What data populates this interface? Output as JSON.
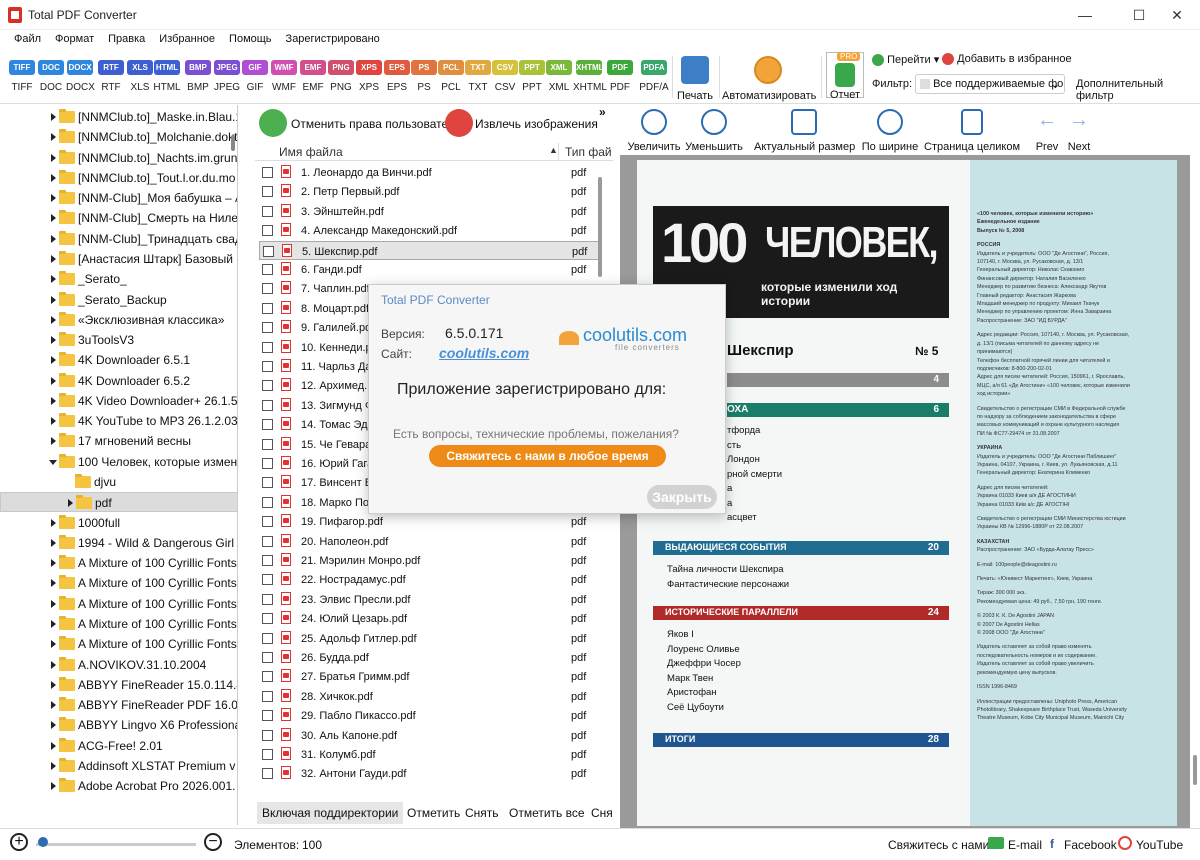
{
  "titlebar": {
    "title": "Total PDF Converter",
    "minimize": "—",
    "maximize": "☐",
    "close": "✕"
  },
  "menu": [
    "Файл",
    "Формат",
    "Правка",
    "Избранное",
    "Помощь",
    "Зарегистрировано"
  ],
  "formats": [
    {
      "label": "TIFF",
      "color": "#2e86de"
    },
    {
      "label": "DOC",
      "color": "#2e86de"
    },
    {
      "label": "DOCX",
      "color": "#2e86de"
    },
    {
      "label": "RTF",
      "color": "#3d5fd1"
    },
    {
      "label": "XLS",
      "color": "#3d5fd1"
    },
    {
      "label": "HTML",
      "color": "#3d5fd1"
    },
    {
      "label": "BMP",
      "color": "#7b4fd1"
    },
    {
      "label": "JPEG",
      "color": "#7b4fd1"
    },
    {
      "label": "GIF",
      "color": "#b04fd1"
    },
    {
      "label": "WMF",
      "color": "#d14fb0"
    },
    {
      "label": "EMF",
      "color": "#d14f8a"
    },
    {
      "label": "PNG",
      "color": "#d14f6a"
    },
    {
      "label": "XPS",
      "color": "#e0443f"
    },
    {
      "label": "EPS",
      "color": "#e05a3f"
    },
    {
      "label": "PS",
      "color": "#e0743f"
    },
    {
      "label": "PCL",
      "color": "#e08e3f"
    },
    {
      "label": "TXT",
      "color": "#e0a83f"
    },
    {
      "label": "CSV",
      "color": "#d4c23a"
    },
    {
      "label": "PPT",
      "color": "#a8c23a"
    },
    {
      "label": "XML",
      "color": "#7ab83a"
    },
    {
      "label": "XHTML",
      "color": "#5ab03a"
    },
    {
      "label": "PDF",
      "color": "#3aa83a"
    },
    {
      "label": "PDF/A",
      "color": "#3aa86a"
    }
  ],
  "toolbar": {
    "print": "Печать",
    "automate": "Автоматизировать",
    "report": "Отчет",
    "pro": "PRO",
    "goto": "Перейти",
    "add_favorite": "Добавить в избранное",
    "filter_label": "Фильтр:",
    "filter_value": "Все поддерживаемые фо",
    "advanced_filter": "Дополнительный фильтр"
  },
  "tree": [
    {
      "label": "[NNMClub.to]_Maske.in.Blau.1",
      "level": 0,
      "state": "closed"
    },
    {
      "label": "[NNMClub.to]_Molchanie.dokt",
      "level": 0,
      "state": "closed"
    },
    {
      "label": "[NNMClub.to]_Nachts.im.grun",
      "level": 0,
      "state": "closed"
    },
    {
      "label": "[NNMClub.to]_Tout.l.or.du.mo",
      "level": 0,
      "state": "closed"
    },
    {
      "label": "[NNM-Club]_Моя бабушка – А",
      "level": 0,
      "state": "closed"
    },
    {
      "label": "[NNM-Club]_Смерть на Ниле",
      "level": 0,
      "state": "closed"
    },
    {
      "label": "[NNM-Club]_Тринадцать свад",
      "level": 0,
      "state": "closed"
    },
    {
      "label": "[Анастасия Штарк] Базовый",
      "level": 0,
      "state": "closed"
    },
    {
      "label": "_Serato_",
      "level": 0,
      "state": "closed"
    },
    {
      "label": "_Serato_Backup",
      "level": 0,
      "state": "closed"
    },
    {
      "label": "«Эксклюзивная классика»",
      "level": 0,
      "state": "closed"
    },
    {
      "label": "3uToolsV3",
      "level": 0,
      "state": "closed"
    },
    {
      "label": "4K Downloader 6.5.1",
      "level": 0,
      "state": "closed"
    },
    {
      "label": "4K Downloader 6.5.2",
      "level": 0,
      "state": "closed"
    },
    {
      "label": "4K Video Downloader+ 26.1.5",
      "level": 0,
      "state": "closed"
    },
    {
      "label": "4K YouTube to MP3 26.1.2.03",
      "level": 0,
      "state": "closed"
    },
    {
      "label": "17 мгновений весны",
      "level": 0,
      "state": "closed"
    },
    {
      "label": "100 Человек, которые измен",
      "level": 0,
      "state": "open"
    },
    {
      "label": "djvu",
      "level": 1,
      "state": "leaf"
    },
    {
      "label": "pdf",
      "level": 1,
      "state": "selected"
    },
    {
      "label": "1000full",
      "level": 0,
      "state": "closed"
    },
    {
      "label": "1994 - Wild & Dangerous Girl",
      "level": 0,
      "state": "closed"
    },
    {
      "label": "A Mixture of 100 Cyrillic Fonts",
      "level": 0,
      "state": "closed"
    },
    {
      "label": "A Mixture of 100 Cyrillic Fonts",
      "level": 0,
      "state": "closed"
    },
    {
      "label": "A Mixture of 100 Cyrillic Fonts",
      "level": 0,
      "state": "closed"
    },
    {
      "label": "A Mixture of 100 Cyrillic Fonts",
      "level": 0,
      "state": "closed"
    },
    {
      "label": "A Mixture of 100 Cyrillic Fonts",
      "level": 0,
      "state": "closed"
    },
    {
      "label": "A.NOVIKOV.31.10.2004",
      "level": 0,
      "state": "closed"
    },
    {
      "label": "ABBYY FineReader 15.0.114.4",
      "level": 0,
      "state": "closed"
    },
    {
      "label": "ABBYY FineReader PDF 16.0.1",
      "level": 0,
      "state": "closed"
    },
    {
      "label": "ABBYY Lingvo X6 Professional",
      "level": 0,
      "state": "closed"
    },
    {
      "label": "ACG-Free! 2.01",
      "level": 0,
      "state": "closed"
    },
    {
      "label": "Addinsoft XLSTAT Premium v",
      "level": 0,
      "state": "closed"
    },
    {
      "label": "Adobe Acrobat Pro 2026.001.",
      "level": 0,
      "state": "closed"
    }
  ],
  "mid": {
    "revoke": "Отменить права пользователя",
    "extract": "Извлечь изображения",
    "more": "»",
    "col_name": "Имя файла",
    "col_type": "Тип фай",
    "include_sub": "Включая поддиректории",
    "check": "Отметить",
    "uncheck": "Снять",
    "check_all": "Отметить все",
    "uncheck_all": "Сня"
  },
  "files": [
    {
      "name": "1. Леонардо да Винчи.pdf",
      "type": "pdf"
    },
    {
      "name": "2. Петр Первый.pdf",
      "type": "pdf"
    },
    {
      "name": "3. Эйнштейн.pdf",
      "type": "pdf"
    },
    {
      "name": "4. Александр Македонский.pdf",
      "type": "pdf"
    },
    {
      "name": "5. Шекспир.pdf",
      "type": "pdf"
    },
    {
      "name": "6. Ганди.pdf",
      "type": "pdf"
    },
    {
      "name": "7. Чаплин.pdf",
      "type": "pdf"
    },
    {
      "name": "8. Моцарт.pdf",
      "type": "pdf"
    },
    {
      "name": "9. Галилей.pdf",
      "type": "pdf"
    },
    {
      "name": "10. Кеннеди.pdf",
      "type": "pdf"
    },
    {
      "name": "11. Чарльз Дарвин.pdf",
      "type": "pdf"
    },
    {
      "name": "12. Архимед.pdf",
      "type": "pdf"
    },
    {
      "name": "13. Зигмунд Фрейд.pdf",
      "type": "pdf"
    },
    {
      "name": "14. Томас Эдисон.pdf",
      "type": "pdf"
    },
    {
      "name": "15. Че Гевара.pdf",
      "type": "pdf"
    },
    {
      "name": "16. Юрий Гагарин.pdf",
      "type": "pdf"
    },
    {
      "name": "17. Винсент Ван Гог.pdf",
      "type": "pdf"
    },
    {
      "name": "18. Марко Поло.pdf",
      "type": "pdf"
    },
    {
      "name": "19. Пифагор.pdf",
      "type": "pdf"
    },
    {
      "name": "20. Наполеон.pdf",
      "type": "pdf"
    },
    {
      "name": "21. Мэрилин Монро.pdf",
      "type": "pdf"
    },
    {
      "name": "22. Нострадамус.pdf",
      "type": "pdf"
    },
    {
      "name": "23. Элвис Пресли.pdf",
      "type": "pdf"
    },
    {
      "name": "24. Юлий Цезарь.pdf",
      "type": "pdf"
    },
    {
      "name": "25. Адольф Гитлер.pdf",
      "type": "pdf"
    },
    {
      "name": "26. Будда.pdf",
      "type": "pdf"
    },
    {
      "name": "27. Братья Гримм.pdf",
      "type": "pdf"
    },
    {
      "name": "28. Хичкок.pdf",
      "type": "pdf"
    },
    {
      "name": "29. Пабло Пикассо.pdf",
      "type": "pdf"
    },
    {
      "name": "30. Аль Капоне.pdf",
      "type": "pdf"
    },
    {
      "name": "31. Колумб.pdf",
      "type": "pdf"
    },
    {
      "name": "32. Антони Гауди.pdf",
      "type": "pdf"
    }
  ],
  "viewer": {
    "zoom_in": "Увеличить",
    "zoom_out": "Уменьшить",
    "actual": "Актуальный размер",
    "fit_width": "По ширине",
    "fit_page": "Страница целиком",
    "prev": "Prev",
    "next": "Next"
  },
  "doc": {
    "banner_num": "100",
    "banner_word": "ЧЕЛОВЕК,",
    "banner_sub": "которые изменили ход истории",
    "heading": "Шекспир",
    "issue": "№ 5",
    "bar1_page": "4",
    "bar2": "ОХА",
    "bar2_page": "6",
    "bar2_items": [
      "тфорда",
      "сть",
      "Лондон",
      "рной смерти",
      "а",
      "а",
      "асцвет"
    ],
    "bar3": "ВЫДАЮЩИЕСЯ СОБЫТИЯ",
    "bar3_page": "20",
    "bar3_items": [
      "Тайна личности Шекспира",
      "Фантастические персонажи"
    ],
    "bar4": "ИСТОРИЧЕСКИЕ ПАРАЛЛЕЛИ",
    "bar4_page": "24",
    "bar4_items": [
      "Яков I",
      "Лоуренс Оливье",
      "Джеффри Чосер",
      "Марк Твен",
      "Аристофан",
      "Сеё Цубоути"
    ],
    "bar5": "ИТОГИ",
    "bar5_page": "28",
    "side_title": "«100 человек, которые изменили историю»",
    "side_sub": "Еженедельное издание",
    "side_issue": "Выпуск № 5, 2008",
    "side_russia": "РОССИЯ",
    "side_russia_lines": [
      "Издатель и учредитель: ООО \"Де Агостини\", Россия,",
      "107140, г. Москва, ул. Русаковская, д. 13/1",
      "Генеральный директор: Николас Скавэнио",
      "Финансовый директор: Наталия Василенко",
      "Менеджер по развитию бизнеса: Александр Якутов",
      "Главный редактор: Анастасия Жаркова",
      "Младший менеджер по продукту: Михаил Ткачук",
      "Менеджер по управлению проектом: Инна Заварзина",
      "Распространение: ЗАО \"ИД БУРДА\""
    ],
    "side_address_lines": [
      "Адрес редакции: Россия, 107140, г. Москва, ул. Русаковская,",
      "д. 13/1 (письма читателей по данному адресу не",
      "принимаются)",
      "Телефон бесплатной горячей линии для читателей и",
      "подписчиков: 8-800-200-02-01",
      "Адрес для писем читателей: Россия, 150961, г. Ярославль,",
      "МЦС, а/я 61 «Де Агостини» «100 человек, которые изменили",
      "ход истории»"
    ],
    "side_reg_lines": [
      "Свидетельство о регистрации СМИ в Федеральной службе",
      "по надзору за соблюдением законодательства в сфере",
      "массовых коммуникаций и охране культурного наследия",
      "ПИ № ФС77-29474 от 31.08.2007"
    ],
    "side_ukraine": "УКРАИНА",
    "side_ukraine_lines": [
      "Издатель и учредитель: ООО \"Де Агостини Паблишинг\"",
      "Украина, 04107, Украина, г. Киев, ул. Лукьяновская, д.11",
      "Генеральный директор: Екатерина Клименко"
    ],
    "side_ukraine_addr": [
      "Адрес для писем читателей:",
      "Украина 01033 Киев а/я ДЕ АГОСТИНИ",
      "Украина 01033 Київ а/с ДЕ АГОСТІНІ"
    ],
    "side_ukraine_reg": [
      "Свидетельство о регистрации СМИ Министерства юстиции",
      "Украины КВ № 12996-1880Р от 22.08.2007"
    ],
    "side_kz": "КАЗАХСТАН",
    "side_kz_line": "Распространение: ЗАО «Бурда-Алатау Пресс»",
    "side_email": "E-mail: 100people@deagostini.ru",
    "side_print": "Печать: «Юнивест Маркетинг», Киев, Украина",
    "side_run": [
      "Тираж: 300 000 экз.",
      "Рекомендуемая цена: 49 руб., 7,50 грн, 190 тенге."
    ],
    "side_copy": [
      "© 2003 К. К. De Agostini JAPAN",
      "© 2007 De Agostini Hellas",
      "© 2008 ООО \"Де Агостини\""
    ],
    "side_rights": [
      "Издатель оставляет за собой право изменять",
      "последовательность номеров и их содержание.",
      "Издатель оставляет за собой право увеличить",
      "рекомендуемую цену выпусков."
    ],
    "side_issn": "ISSN 1996-8469",
    "side_ill": [
      "Иллюстрации предоставлены: Uniphoto Press, American",
      "Photolibrary, Shakespeare Birthplace Trust, Waseda University",
      "Theatre Museum, Kobe City Municipal Museum, Mainichi City"
    ]
  },
  "about": {
    "title": "Total PDF Converter",
    "version_label": "Версия:",
    "version": "6.5.0.171",
    "site_label": "Сайт:",
    "site": "coolutils.com",
    "logo": "coolutils.com",
    "logo_sub": "file converters",
    "registered": "Приложение зарегистрировано для:",
    "question": "Есть вопросы, технические проблемы, пожелания?",
    "contact": "Свяжитесь с нами в любое время",
    "close": "Закрыть"
  },
  "status": {
    "plus": "+",
    "minus": "−",
    "items_label": "Элементов:",
    "items": "100",
    "contact": "Свяжитесь с нами",
    "email": "E-mail",
    "facebook": "Facebook",
    "youtube": "YouTube"
  }
}
